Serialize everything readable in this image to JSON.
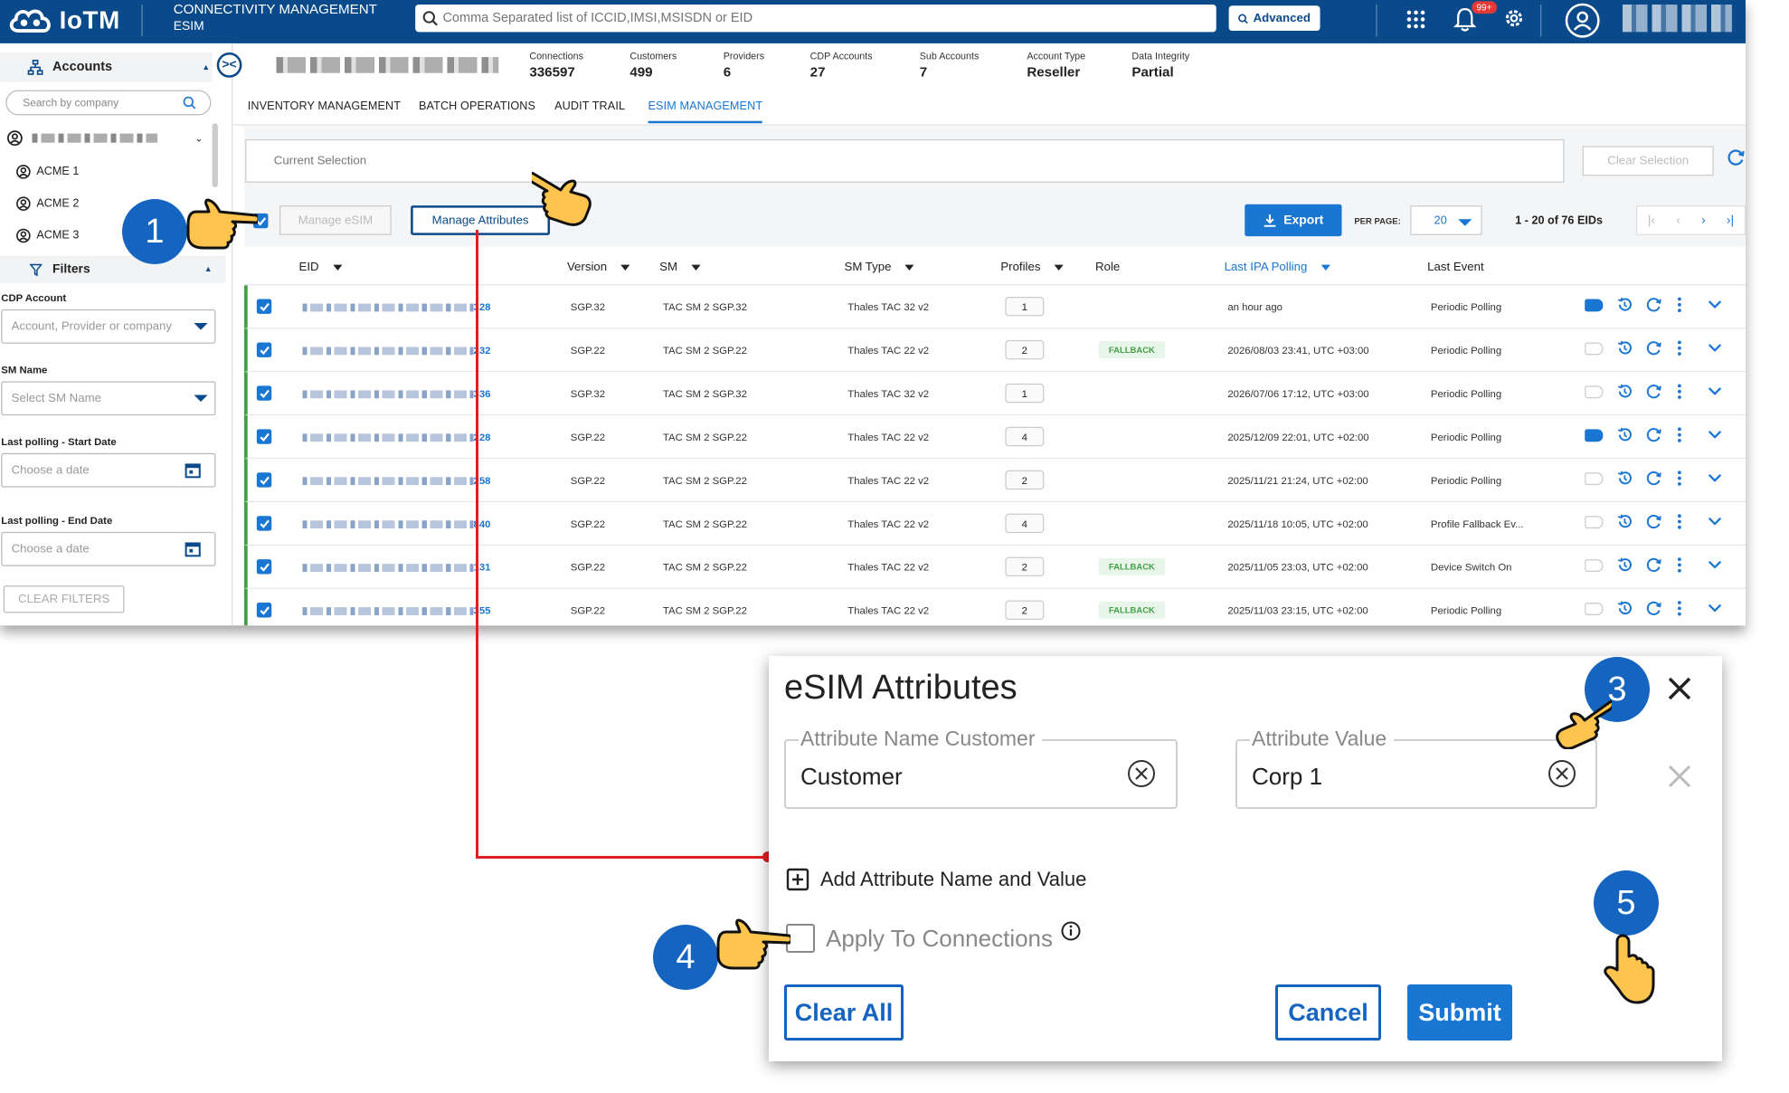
{
  "header": {
    "logo": "IoTM",
    "title_line1": "CONNECTIVITY MANAGEMENT",
    "title_line2": "ESIM",
    "search_placeholder": "Comma Separated list of ICCID,IMSI,MSISDN or EID",
    "advanced_label": "Advanced",
    "notification_badge": "99+"
  },
  "sidebar": {
    "accounts_label": "Accounts",
    "search_placeholder": "Search by company",
    "companies": [
      "ACME 1",
      "ACME 2",
      "ACME 3"
    ],
    "filters_label": "Filters",
    "cdp_account_label": "CDP Account",
    "cdp_account_placeholder": "Account, Provider or company",
    "sm_name_label": "SM Name",
    "sm_name_placeholder": "Select SM Name",
    "start_date_label": "Last polling - Start Date",
    "start_date_placeholder": "Choose a date",
    "end_date_label": "Last polling - End Date",
    "end_date_placeholder": "Choose a date",
    "clear_filters": "CLEAR FILTERS"
  },
  "stats": [
    {
      "label": "Connections",
      "value": "336597"
    },
    {
      "label": "Customers",
      "value": "499"
    },
    {
      "label": "Providers",
      "value": "6"
    },
    {
      "label": "CDP Accounts",
      "value": "27"
    },
    {
      "label": "Sub Accounts",
      "value": "7"
    },
    {
      "label": "Account Type",
      "value": "Reseller"
    },
    {
      "label": "Data Integrity",
      "value": "Partial"
    }
  ],
  "tabs": [
    "INVENTORY MANAGEMENT",
    "BATCH OPERATIONS",
    "AUDIT TRAIL",
    "ESIM MANAGEMENT"
  ],
  "toolbar": {
    "current_selection": "Current Selection",
    "clear_selection": "Clear Selection",
    "manage_esim": "Manage eSIM",
    "manage_attributes": "Manage Attributes",
    "export": "Export",
    "per_page_label": "PER PAGE:",
    "per_page_value": "20",
    "range": "1 - 20 of 76 EIDs"
  },
  "table": {
    "columns": [
      "EID",
      "Version",
      "SM",
      "SM Type",
      "Profiles",
      "Role",
      "Last IPA Polling",
      "Last Event"
    ],
    "rows": [
      {
        "eid_tail": "328",
        "version": "SGP.32",
        "sm": "TAC SM 2 SGP.32",
        "sm_type": "Thales TAC 32 v2",
        "profiles": "1",
        "role": "",
        "polling": "an hour ago",
        "event": "Periodic Polling",
        "tagged": true
      },
      {
        "eid_tail": "232",
        "version": "SGP.22",
        "sm": "TAC SM 2 SGP.22",
        "sm_type": "Thales TAC 22 v2",
        "profiles": "2",
        "role": "FALLBACK",
        "polling": "2026/08/03 23:41, UTC +03:00",
        "event": "Periodic Polling",
        "tagged": false
      },
      {
        "eid_tail": "336",
        "version": "SGP.32",
        "sm": "TAC SM 2 SGP.32",
        "sm_type": "Thales TAC 32 v2",
        "profiles": "1",
        "role": "",
        "polling": "2026/07/06 17:12, UTC +03:00",
        "event": "Periodic Polling",
        "tagged": false
      },
      {
        "eid_tail": "228",
        "version": "SGP.22",
        "sm": "TAC SM 2 SGP.22",
        "sm_type": "Thales TAC 22 v2",
        "profiles": "4",
        "role": "",
        "polling": "2025/12/09 22:01, UTC +02:00",
        "event": "Periodic Polling",
        "tagged": true
      },
      {
        "eid_tail": "258",
        "version": "SGP.22",
        "sm": "TAC SM 2 SGP.22",
        "sm_type": "Thales TAC 22 v2",
        "profiles": "2",
        "role": "",
        "polling": "2025/11/21 21:24, UTC +02:00",
        "event": "Periodic Polling",
        "tagged": false
      },
      {
        "eid_tail": "840",
        "version": "SGP.22",
        "sm": "TAC SM 2 SGP.22",
        "sm_type": "Thales TAC 22 v2",
        "profiles": "4",
        "role": "",
        "polling": "2025/11/18 10:05, UTC +02:00",
        "event": "Profile Fallback Ev...",
        "tagged": false
      },
      {
        "eid_tail": "131",
        "version": "SGP.22",
        "sm": "TAC SM 2 SGP.22",
        "sm_type": "Thales TAC 22 v2",
        "profiles": "2",
        "role": "FALLBACK",
        "polling": "2025/11/05 23:03, UTC +02:00",
        "event": "Device Switch On",
        "tagged": false
      },
      {
        "eid_tail": "355",
        "version": "SGP.22",
        "sm": "TAC SM 2 SGP.22",
        "sm_type": "Thales TAC 22 v2",
        "profiles": "2",
        "role": "FALLBACK",
        "polling": "2025/11/03 23:15, UTC +02:00",
        "event": "Periodic Polling",
        "tagged": false
      }
    ]
  },
  "dialog": {
    "title": "eSIM Attributes",
    "name_label": "Attribute Name Customer",
    "name_value": "Customer",
    "value_label": "Attribute Value",
    "value_value": "Corp 1",
    "add_label": "Add Attribute Name and Value",
    "apply_label": "Apply To Connections",
    "clear_all": "Clear All",
    "cancel": "Cancel",
    "submit": "Submit"
  },
  "steps": [
    "1",
    "3",
    "4",
    "5"
  ],
  "colors": {
    "brand": "#0a4a8a",
    "accent": "#1976d2",
    "step": "#1565c0",
    "connector": "#e02020",
    "fallback": "#43a047"
  },
  "icons": [
    "iot-cloud-icon",
    "search-icon",
    "apps-grid-icon",
    "bell-icon",
    "gear-icon",
    "user-icon",
    "calendar-icon",
    "export-icon",
    "refresh-icon",
    "close-icon",
    "info-icon",
    "plus-square-icon",
    "pointing-hand-icon"
  ]
}
